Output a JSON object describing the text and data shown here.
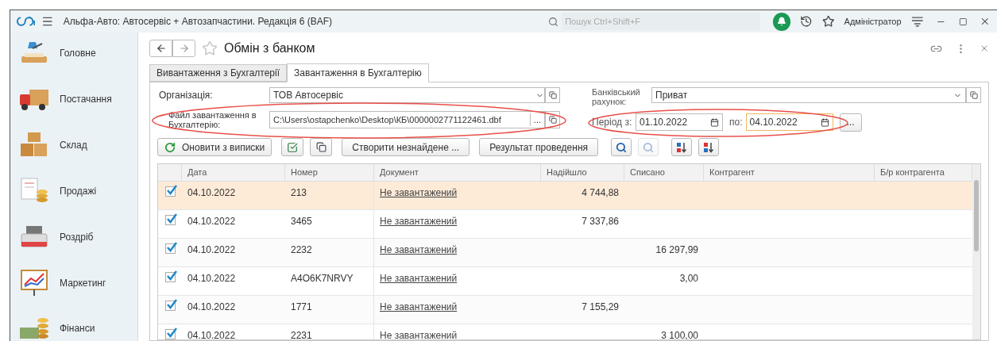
{
  "window": {
    "title": "Альфа-Авто: Автосервіс + Автозапчастини. Редакція 6  (BAF)",
    "search_placeholder": "Пошук Ctrl+Shift+F",
    "user": "Адміністратор"
  },
  "sidebar": {
    "items": [
      {
        "label": "Головне",
        "kind": "desk"
      },
      {
        "label": "Постачання",
        "kind": "truck"
      },
      {
        "label": "Склад",
        "kind": "boxes"
      },
      {
        "label": "Продажі",
        "kind": "sales"
      },
      {
        "label": "Роздріб",
        "kind": "register"
      },
      {
        "label": "Маркетинг",
        "kind": "chart"
      },
      {
        "label": "Фінанси",
        "kind": "money"
      }
    ]
  },
  "page": {
    "title": "Обмін з банком"
  },
  "tabs": [
    {
      "label": "Вивантаження з Бухгалтерії",
      "selected": false
    },
    {
      "label": "Завантаження в Бухгалтерію",
      "selected": true
    }
  ],
  "form": {
    "organization": {
      "label": "Організація:",
      "value": "ТОВ Автосервіс"
    },
    "file": {
      "label": "Файл завантаження в Бухгалтерію:",
      "value": "C:\\Users\\ostapchenko\\Desktop\\КБ\\0000002771122461.dbf"
    },
    "bank_account": {
      "label": "Банківський рахунок:",
      "value": "Приват"
    },
    "period": {
      "label_from": "Період з:",
      "from": "01.10.2022",
      "label_to": "по:",
      "to": "04.10.2022",
      "more": "..."
    }
  },
  "toolbar": [
    {
      "kind": "refresh",
      "label": "Оновити з виписки",
      "disabled": false
    },
    {
      "kind": "check-all",
      "disabled": false
    },
    {
      "kind": "copy",
      "disabled": false
    },
    {
      "kind": "text",
      "label": "Створити незнайдене ...",
      "disabled": false
    },
    {
      "kind": "text",
      "label": "Результат проведення",
      "disabled": false
    },
    {
      "kind": "find",
      "disabled": false
    },
    {
      "kind": "clear-find",
      "disabled": true
    },
    {
      "kind": "sort-asc",
      "disabled": false
    },
    {
      "kind": "sort-desc",
      "disabled": false
    }
  ],
  "table": {
    "columns": [
      "Дата",
      "Номер",
      "Документ",
      "Надійшло",
      "Списано",
      "Контрагент",
      "Б/р контрагента"
    ],
    "rows": [
      {
        "checked": true,
        "selected": true,
        "date": "04.10.2022",
        "number": "213",
        "document": "Не завантажений",
        "incoming": "4 744,88",
        "outgoing": ""
      },
      {
        "checked": true,
        "selected": false,
        "date": "04.10.2022",
        "number": "3465",
        "document": "Не завантажений",
        "incoming": "7 337,86",
        "outgoing": ""
      },
      {
        "checked": true,
        "selected": false,
        "date": "04.10.2022",
        "number": "2232",
        "document": "Не завантажений",
        "incoming": "",
        "outgoing": "16 297,99"
      },
      {
        "checked": true,
        "selected": false,
        "date": "04.10.2022",
        "number": "A4O6K7NRVY",
        "document": "Не завантажений",
        "incoming": "",
        "outgoing": "3,00"
      },
      {
        "checked": true,
        "selected": false,
        "date": "04.10.2022",
        "number": "1771",
        "document": "Не завантажений",
        "incoming": "7 155,29",
        "outgoing": ""
      },
      {
        "checked": true,
        "selected": false,
        "date": "04.10.2022",
        "number": "2231",
        "document": "Не завантажений",
        "incoming": "",
        "outgoing": "3 100,00"
      }
    ]
  }
}
